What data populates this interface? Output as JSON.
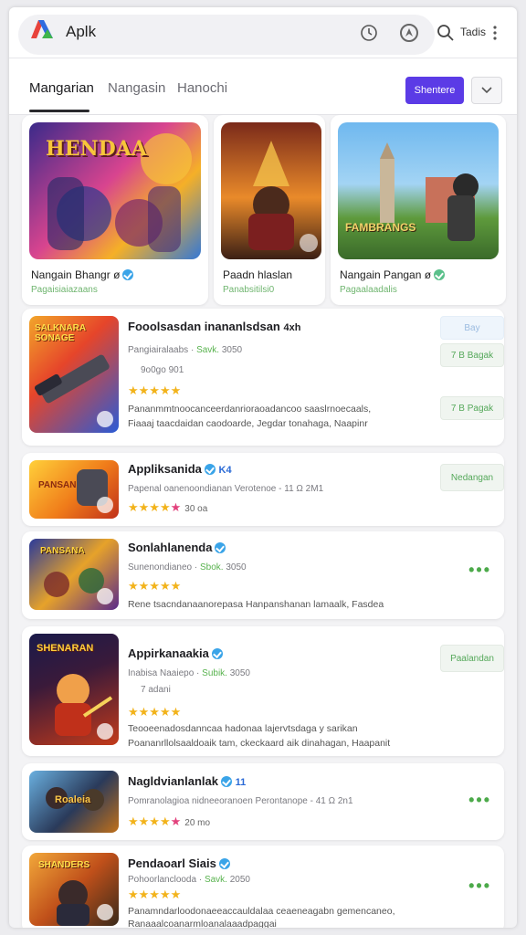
{
  "header": {
    "app_name": "Aplk",
    "right_label": "Tadis",
    "icons": [
      "clock-icon",
      "compass-icon",
      "search-icon",
      "more-vertical-icon"
    ]
  },
  "tabs": [
    {
      "label": "Mangarian",
      "active": true
    },
    {
      "label": "Nangasin",
      "active": false
    },
    {
      "label": "Hanochi",
      "active": false
    }
  ],
  "primary_button": "Shentere",
  "colors": {
    "accent": "#5b3be6",
    "green": "#59b34f",
    "star": "#f2b31b",
    "verified": "#3aa4e8"
  },
  "featured": [
    {
      "art_text": "HENDAA",
      "name": "Nangain Bhangr ø",
      "sub": "Pagaisiaiazaans"
    },
    {
      "art_text": "",
      "name": "Paadn hlaslan",
      "sub": "Panabsitilsi0"
    },
    {
      "art_text": "FAMBRANGS",
      "name": "Nangain Pangan ø",
      "sub": "Pagaalaadalis"
    }
  ],
  "apps": [
    {
      "title": "Fooolsasdan inananlsdsan",
      "title_suffix": "4xh",
      "meta": "Pangiairalaabs",
      "meta_green": "Savk.",
      "meta_tail": "3050",
      "extra": "9o0go 901",
      "stars": "★★★★★",
      "count": "",
      "desc1": "Pananmmtnoocanceerdanrioraoadancoo saaslrnoecaals,",
      "desc2": "Fiaaaj taacdaidan caodoarde, Jegdar tonahaga, Naapinr",
      "thumb_text": "SALKNARA SONAGE",
      "buttons": [
        "Bay",
        "7 B Bagak",
        "7 B Pagak"
      ]
    },
    {
      "title": "Appliksanida",
      "title_suffix": "K4",
      "meta": "Papenal oanenoondianan Verotenoe - 11 Ω 2M1",
      "meta_green": "",
      "meta_tail": "",
      "extra": "",
      "stars": "★★★★",
      "star_extra": "★",
      "count": "30 oa",
      "desc1": "",
      "desc2": "",
      "thumb_text": "PANSAN",
      "buttons": [
        "Nedangan"
      ]
    },
    {
      "title": "Sonlahlanenda",
      "title_suffix": "",
      "meta": "Sunenondianeo",
      "meta_green": "Sbok.",
      "meta_tail": "3050",
      "extra": "",
      "stars": "★★★★★",
      "count": "",
      "desc1": "Rene tsacndanaanorepasa Hanpanshanan lamaalk, Fasdea",
      "desc2": "",
      "thumb_text": "PANSANA",
      "buttons": []
    },
    {
      "title": "Appirkanaakia",
      "title_suffix": "",
      "meta": "Inabisa Naaiepo",
      "meta_green": "Subik.",
      "meta_tail": "3050",
      "extra": "7 adani",
      "stars": "★★★★★",
      "count": "",
      "desc1": "Teooeenadosdanncaa hadonaa lajervtsdaga y sarikan",
      "desc2": "Poananrllolsaaldoaik tam, ckeckaard aik dinahagan, Haapanit",
      "thumb_text": "SHENARAN",
      "buttons": [
        "Paalandan"
      ]
    },
    {
      "title": "Nagldvianlanlak",
      "title_suffix": "11",
      "meta": "Pomranolagioa nidneeoranoen Perontanope - 41 Ω 2n1",
      "meta_green": "",
      "meta_tail": "",
      "extra": "",
      "stars": "★★★★",
      "star_extra": "★",
      "count": "20 mo",
      "desc1": "",
      "desc2": "",
      "thumb_text": "Roaleia",
      "buttons": []
    },
    {
      "title": "Pendaoarl Siais",
      "title_suffix": "",
      "meta": "Pohoorlanclooda",
      "meta_green": "Savk.",
      "meta_tail": "2050",
      "extra": "",
      "stars": "★★★★★",
      "count": "",
      "desc1": "Panamndarloodonaeeaccauldalaa ceaeneagabn gemencaneo,",
      "desc2": "Ranaaalcoanarmloanalaaadpaggai",
      "thumb_text": "SHANDERS",
      "buttons": []
    }
  ]
}
